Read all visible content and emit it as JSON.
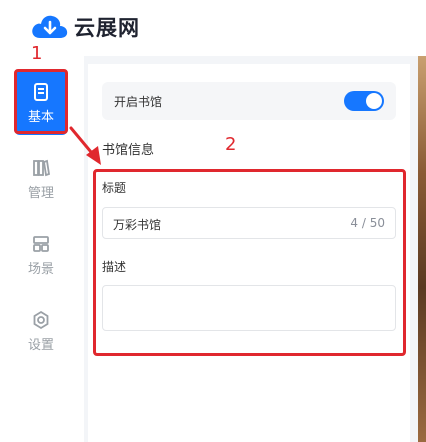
{
  "brand": {
    "name": "云展网",
    "logo_icon": "cloud-logo-icon",
    "logo_color": "#1677ff"
  },
  "sidebar": {
    "items": [
      {
        "label": "基本",
        "icon": "document-icon",
        "active": true
      },
      {
        "label": "管理",
        "icon": "books-icon",
        "active": false
      },
      {
        "label": "场景",
        "icon": "layout-icon",
        "active": false
      },
      {
        "label": "设置",
        "icon": "gear-icon",
        "active": false
      }
    ],
    "active_color": "#1677ff"
  },
  "main": {
    "toggle": {
      "label": "开启书馆",
      "on": true
    },
    "section_title": "书馆信息",
    "title_field": {
      "label": "标题",
      "value": "万彩书馆",
      "counter": "4 / 50"
    },
    "desc_field": {
      "label": "描述",
      "value": ""
    }
  },
  "annotations": {
    "marker_1": "1",
    "marker_2": "2",
    "color": "#e0282e"
  }
}
